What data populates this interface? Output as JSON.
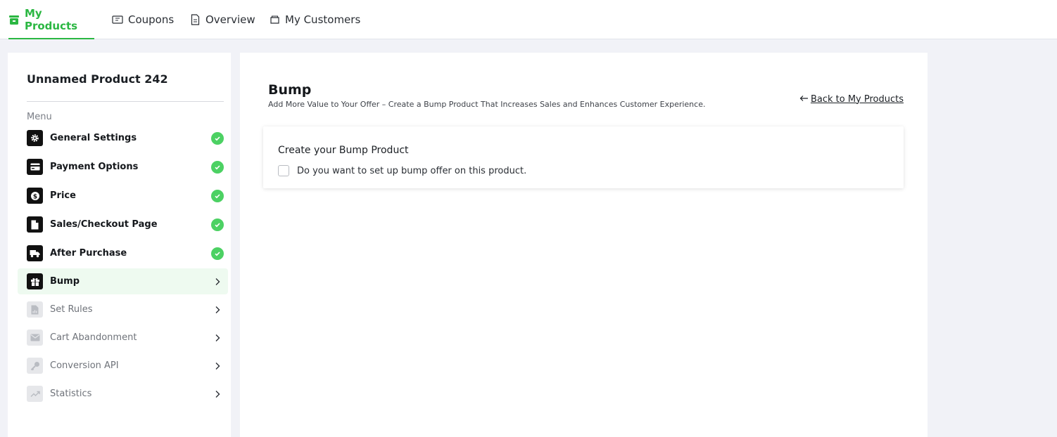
{
  "tabs": [
    {
      "label": "My Products",
      "icon": "store-icon",
      "active": true
    },
    {
      "label": "Coupons",
      "icon": "coupon-icon"
    },
    {
      "label": "Overview",
      "icon": "document-icon"
    },
    {
      "label": "My Customers",
      "icon": "folder-icon"
    }
  ],
  "sidebar": {
    "product_title": "Unnamed Product 242",
    "menu_label": "Menu",
    "items": [
      {
        "label": "General Settings",
        "icon": "gear-icon",
        "state": "complete"
      },
      {
        "label": "Payment Options",
        "icon": "credit-card-icon",
        "state": "complete"
      },
      {
        "label": "Price",
        "icon": "dollar-icon",
        "state": "complete"
      },
      {
        "label": "Sales/Checkout Page",
        "icon": "file-icon",
        "state": "complete"
      },
      {
        "label": "After Purchase",
        "icon": "truck-icon",
        "state": "complete"
      },
      {
        "label": "Bump",
        "icon": "gift-icon",
        "state": "active"
      },
      {
        "label": "Set Rules",
        "icon": "rules-doc-icon",
        "state": "disabled"
      },
      {
        "label": "Cart Abandonment",
        "icon": "envelope-icon",
        "state": "disabled"
      },
      {
        "label": "Conversion API",
        "icon": "key-icon",
        "state": "disabled"
      },
      {
        "label": "Statistics",
        "icon": "trend-icon",
        "state": "disabled"
      }
    ]
  },
  "main": {
    "title": "Bump",
    "subtitle": "Add More Value to Your Offer – Create a Bump Product That Increases Sales and Enhances Customer Experience.",
    "back_link": "Back to My Products",
    "card": {
      "title": "Create your Bump Product",
      "checkbox_label": "Do you want to set up bump offer on this product.",
      "checked": false
    }
  },
  "colors": {
    "accent": "#2bb742",
    "check": "#4cd163",
    "background": "#f1f2f7",
    "active_item_bg": "#eefaf0"
  }
}
